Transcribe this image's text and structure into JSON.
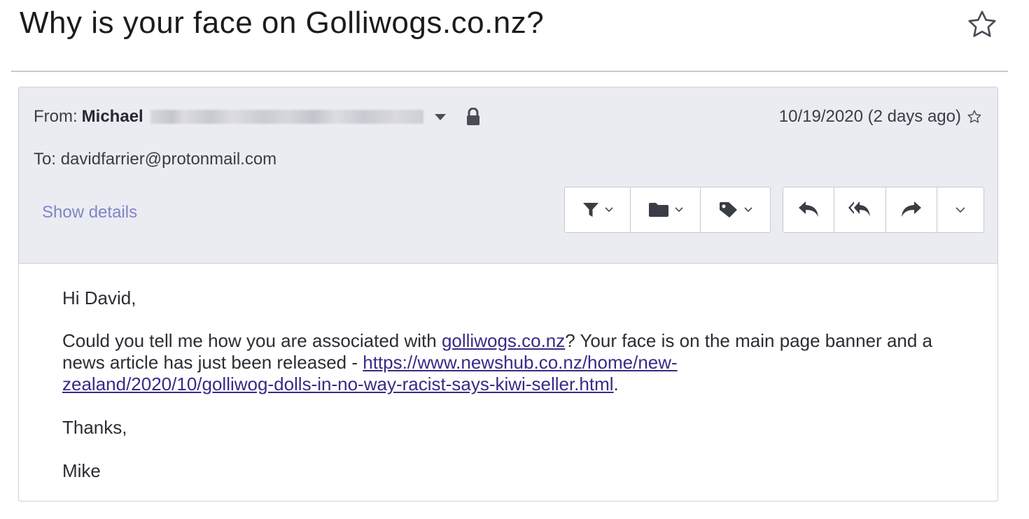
{
  "subject": "Why is your face on Golliwogs.co.nz?",
  "header": {
    "from_label": "From:",
    "from_name": "Michael",
    "to_label": "To:",
    "to_address": "davidfarrier@protonmail.com",
    "date": "10/19/2020 (2 days ago)",
    "show_details": "Show details"
  },
  "toolbar": {
    "group1": [
      "filter-icon",
      "folder-icon",
      "tag-icon"
    ],
    "group2": [
      "reply-icon",
      "reply-all-icon",
      "forward-icon",
      "more-icon"
    ]
  },
  "body": {
    "greeting": "Hi David,",
    "p1_before": "Could you tell me how you are associated with ",
    "link1": "golliwogs.co.nz",
    "p1_middle": "?  Your face is on the main page banner and a news article has just been released - ",
    "link2_line1": "https://www.newshub.co.nz/home/new-",
    "link2_line2": "zealand/2020/10/golliwog-dolls-in-no-way-racist-says-kiwi-seller.html",
    "p1_after": ".",
    "thanks": "Thanks,",
    "signature": "Mike"
  },
  "colors": {
    "header_bg": "#ebebf2",
    "link": "#3a2a86",
    "show_details": "#7f86c4"
  }
}
